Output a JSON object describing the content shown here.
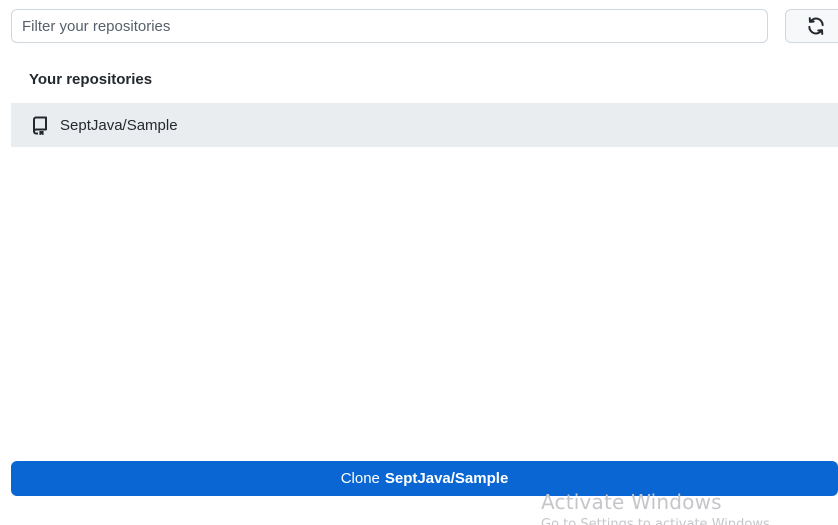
{
  "filter": {
    "placeholder": "Filter your repositories",
    "value": ""
  },
  "refresh": {
    "icon": "refresh-icon"
  },
  "repositories": {
    "heading": "Your repositories",
    "items": [
      {
        "name": "SeptJava/Sample",
        "icon": "repo-icon"
      }
    ]
  },
  "clone": {
    "prefix": "Clone",
    "target": "SeptJava/Sample",
    "color": "#0a66d2"
  },
  "watermark": {
    "title": "Activate Windows",
    "subtitle": "Go to Settings to activate Windows."
  }
}
